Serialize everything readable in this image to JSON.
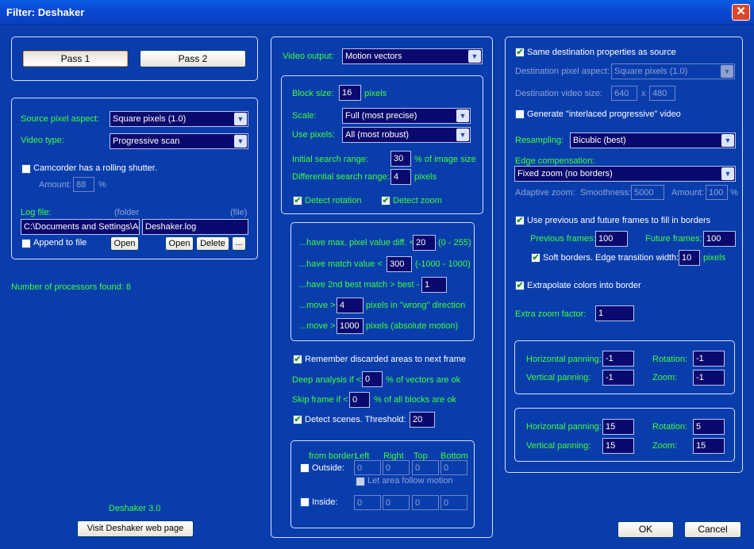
{
  "window": {
    "title": "Filter: Deshaker",
    "close_glyph": "✕"
  },
  "left": {
    "pass1": "Pass 1",
    "pass2": "Pass 2",
    "source_pixel_aspect_label": "Source pixel aspect:",
    "source_pixel_aspect_value": "Square pixels  (1.0)",
    "video_type_label": "Video type:",
    "video_type_value": "Progressive scan",
    "rolling_shutter_label": "Camcorder has a rolling shutter.",
    "amount_label": "Amount:",
    "amount_value": "88",
    "amount_unit": "%",
    "log_file_label": "Log file:",
    "folder_label": "(folder",
    "file_label": "(file)",
    "folder_value": "C:\\Documents and Settings\\Ad",
    "file_value": "Deshaker.log",
    "append_label": "Append to file",
    "open_label": "Open",
    "delete_label": "Delete",
    "browse_label": "...",
    "processors_text": "Number of processors found:  8",
    "version": "Deshaker 3.0",
    "web_button": "Visit Deshaker web page"
  },
  "middle": {
    "video_output_label": "Video output:",
    "video_output_value": "Motion vectors",
    "block_size_label": "Block size:",
    "block_size_value": "16",
    "pixels": "pixels",
    "scale_label": "Scale:",
    "scale_value": "Full  (most precise)",
    "use_pixels_label": "Use pixels:",
    "use_pixels_value": "All  (most robust)",
    "initial_search_label": "Initial search range:",
    "initial_search_value": "30",
    "initial_search_unit": "% of image size",
    "diff_search_label": "Differential search range:",
    "diff_search_value": "4",
    "diff_search_unit": "pixels",
    "detect_rotation": "Detect rotation",
    "detect_zoom": "Detect zoom",
    "discard": {
      "max_pixel_label": "...have max. pixel value diff. <",
      "max_pixel_value": "20",
      "max_pixel_range": "(0 - 255)",
      "match_label": "...have match value <",
      "match_value": "300",
      "match_range": "(-1000 - 1000)",
      "second_best_label": "...have 2nd best match > best -",
      "second_best_value": "1",
      "move_wrong_prefix": "...move >",
      "move_wrong_value": "4",
      "move_wrong_suffix": "pixels in \"wrong\" direction",
      "move_abs_prefix": "...move >",
      "move_abs_value": "1000",
      "move_abs_suffix": "pixels (absolute motion)"
    },
    "remember_label": "Remember discarded areas to next frame",
    "deep_prefix": "Deep analysis if <",
    "deep_value": "0",
    "deep_suffix": "% of vectors are ok",
    "skip_prefix": "Skip frame if <",
    "skip_value": "0",
    "skip_suffix": "% of all blocks are ok",
    "detect_scenes_label": "Detect scenes. Threshold:",
    "detect_scenes_value": "20",
    "ignore": {
      "from_border": "from border:",
      "left": "Left",
      "right": "Right",
      "top": "Top",
      "bottom": "Bottom",
      "outside": "Outside:",
      "let_follow": "Let area follow motion",
      "inside": "Inside:",
      "outside_values": [
        "0",
        "0",
        "0",
        "0"
      ],
      "inside_values": [
        "0",
        "0",
        "0",
        "0"
      ]
    }
  },
  "right": {
    "same_dest": "Same destination properties as source",
    "dest_aspect_label": "Destination pixel aspect:",
    "dest_aspect_value": "Square pixels  (1.0)",
    "dest_size_label": "Destination video size:",
    "dest_width": "640",
    "dest_x": "x",
    "dest_height": "480",
    "interlaced_label": "Generate \"interlaced progressive\" video",
    "resampling_label": "Resampling:",
    "resampling_value": "Bicubic  (best)",
    "edge_comp_label": "Edge compensation:",
    "edge_comp_value": "Fixed zoom  (no borders)",
    "adaptive_label": "Adaptive zoom:",
    "smoothness_label": "Smoothness:",
    "smoothness_value": "5000",
    "adaptive_amount_label": "Amount:",
    "adaptive_amount_value": "100",
    "adaptive_amount_unit": "%",
    "use_prev_future": "Use previous and future frames to fill in borders",
    "previous_frames_label": "Previous frames:",
    "previous_frames_value": "100",
    "future_frames_label": "Future frames:",
    "future_frames_value": "100",
    "soft_borders_label": "Soft borders. Edge transition width:",
    "soft_borders_value": "10",
    "soft_borders_unit": "pixels",
    "extrapolate_label": "Extrapolate colors into border",
    "extra_zoom_label": "Extra zoom factor:",
    "extra_zoom_value": "1",
    "smooth1": {
      "h_pan_label": "Horizontal panning:",
      "h_pan": "-1",
      "rot_label": "Rotation:",
      "rot": "-1",
      "v_pan_label": "Vertical panning:",
      "v_pan": "-1",
      "zoom_label": "Zoom:",
      "zoom": "-1"
    },
    "smooth2": {
      "h_pan_label": "Horizontal panning:",
      "h_pan": "15",
      "rot_label": "Rotation:",
      "rot": "5",
      "v_pan_label": "Vertical panning:",
      "v_pan": "15",
      "zoom_label": "Zoom:",
      "zoom": "15"
    },
    "ok": "OK",
    "cancel": "Cancel"
  },
  "icons": {
    "check": "✔",
    "dropdown": "▼"
  }
}
